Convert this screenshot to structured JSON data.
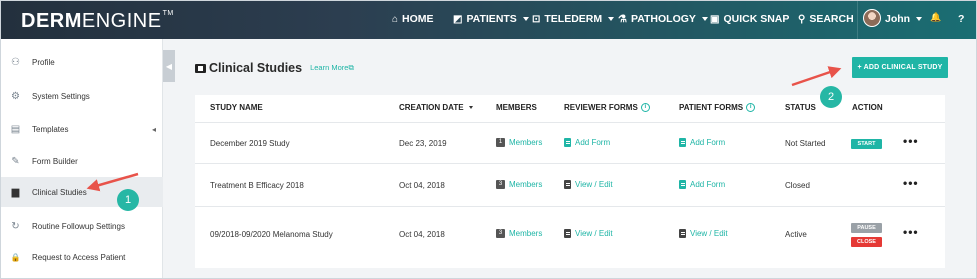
{
  "nav": {
    "logo_bold": "DERM",
    "logo_light": "ENGINE",
    "logo_tm": "TM",
    "items": [
      {
        "label": "HOME",
        "icon": "home-icon",
        "glyph": "⌂",
        "caret": false
      },
      {
        "label": "PATIENTS",
        "icon": "patients-icon",
        "glyph": "◩",
        "caret": true
      },
      {
        "label": "TELEDERM",
        "icon": "telederm-icon",
        "glyph": "⊡",
        "caret": true
      },
      {
        "label": "PATHOLOGY",
        "icon": "pathology-icon",
        "glyph": "⚗",
        "caret": true
      },
      {
        "label": "QUICK SNAP",
        "icon": "camera-icon",
        "glyph": "▣",
        "caret": false
      },
      {
        "label": "SEARCH",
        "icon": "search-icon",
        "glyph": "⚲",
        "caret": false
      }
    ],
    "user_name": "John",
    "bell_glyph": "🔔",
    "help_glyph": "?"
  },
  "sidebar": {
    "collapse_glyph": "◀",
    "items": [
      {
        "label": "Profile",
        "icon": "profile-icon",
        "glyph": "⚇",
        "active": false
      },
      {
        "label": "System Settings",
        "icon": "gear-icon",
        "glyph": "⚙",
        "active": false
      },
      {
        "label": "Templates",
        "icon": "templates-icon",
        "glyph": "▤",
        "active": false,
        "chevron": "◂"
      },
      {
        "label": "Form Builder",
        "icon": "form-builder-icon",
        "glyph": "✎",
        "active": false
      },
      {
        "label": "Clinical Studies",
        "icon": "folder-icon",
        "glyph": "▆",
        "active": true
      },
      {
        "label": "Routine Followup Settings",
        "icon": "followup-icon",
        "glyph": "↻",
        "active": false
      },
      {
        "label": "Request to Access Patient",
        "icon": "lock-icon",
        "glyph": "🔒",
        "active": false
      }
    ]
  },
  "page": {
    "title": "Clinical Studies",
    "learn_more": "Learn More",
    "learn_more_glyph": "⧉",
    "add_button": "+ ADD CLINICAL STUDY"
  },
  "table": {
    "headers": {
      "study_name": "STUDY NAME",
      "creation_date": "CREATION DATE",
      "members": "MEMBERS",
      "reviewer_forms": "REVIEWER FORMS",
      "patient_forms": "PATIENT FORMS",
      "status": "STATUS",
      "action": "ACTION",
      "info_glyph": "i"
    },
    "rows": [
      {
        "name": "December 2019 Study",
        "date": "Dec 23, 2019",
        "member_count": "1",
        "members_label": "Members",
        "reviewer_form": "Add Form",
        "patient_form": "Add Form",
        "status": "Not Started",
        "actions": [
          "START"
        ],
        "more": "•••"
      },
      {
        "name": "Treatment B Efficacy 2018",
        "date": "Oct 04, 2018",
        "member_count": "3",
        "members_label": "Members",
        "reviewer_form": "View / Edit",
        "patient_form": "Add Form",
        "status": "Closed",
        "actions": [],
        "more": "•••"
      },
      {
        "name": "09/2018-09/2020 Melanoma Study",
        "date": "Oct 04, 2018",
        "member_count": "3",
        "members_label": "Members",
        "reviewer_form": "View / Edit",
        "patient_form": "View / Edit",
        "status": "Active",
        "actions": [
          "PAUSE",
          "CLOSE"
        ],
        "more": "•••"
      }
    ]
  },
  "annotations": {
    "step1": "1",
    "step2": "2"
  },
  "colors": {
    "accent": "#1fb5a6",
    "start": "#1fb5a6",
    "pause": "#9aa1a7",
    "close": "#e53935",
    "annotation": "#26b7a5",
    "arrow": "#e8534a"
  }
}
